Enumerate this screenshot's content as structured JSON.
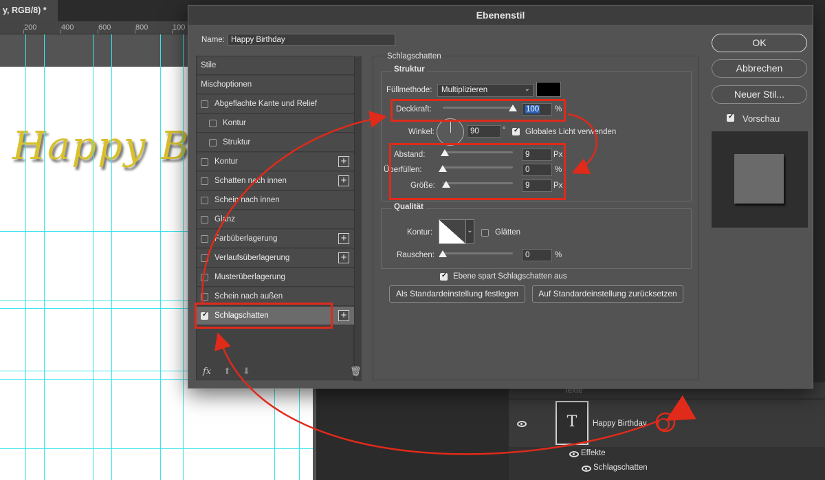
{
  "document": {
    "tab_title": "y, RGB/8) *",
    "ruler_ticks": [
      "200",
      "400",
      "600",
      "800",
      "100"
    ],
    "canvas_text": "Happy Bi"
  },
  "dialog": {
    "title": "Ebenenstil",
    "name_label": "Name:",
    "name_value": "Happy Birthday"
  },
  "styles_list": {
    "items": [
      {
        "label": "Stile",
        "checkbox": false,
        "checked": false,
        "plus": false
      },
      {
        "label": "Mischoptionen",
        "checkbox": false,
        "checked": false,
        "plus": false
      },
      {
        "label": "Abgeflachte Kante und Relief",
        "checkbox": true,
        "checked": false,
        "plus": false
      },
      {
        "label": "Kontur",
        "checkbox": true,
        "checked": false,
        "plus": false,
        "indent": true
      },
      {
        "label": "Struktur",
        "checkbox": true,
        "checked": false,
        "plus": false,
        "indent": true
      },
      {
        "label": "Kontur",
        "checkbox": true,
        "checked": false,
        "plus": true
      },
      {
        "label": "Schatten nach innen",
        "checkbox": true,
        "checked": false,
        "plus": true
      },
      {
        "label": "Schein nach innen",
        "checkbox": true,
        "checked": false,
        "plus": false
      },
      {
        "label": "Glanz",
        "checkbox": true,
        "checked": false,
        "plus": false
      },
      {
        "label": "Farbüberlagerung",
        "checkbox": true,
        "checked": false,
        "plus": true
      },
      {
        "label": "Verlaufsüberlagerung",
        "checkbox": true,
        "checked": false,
        "plus": true
      },
      {
        "label": "Musterüberlagerung",
        "checkbox": true,
        "checked": false,
        "plus": false
      },
      {
        "label": "Schein nach außen",
        "checkbox": true,
        "checked": false,
        "plus": false
      },
      {
        "label": "Schlagschatten",
        "checkbox": true,
        "checked": true,
        "plus": true,
        "active": true
      }
    ],
    "fx_label": "fx"
  },
  "shadow": {
    "section_title": "Schlagschatten",
    "structure_title": "Struktur",
    "blend_mode_label": "Füllmethode:",
    "blend_mode_value": "Multiplizieren",
    "shadow_color": "#000000",
    "opacity_label": "Deckkraft:",
    "opacity_value": "100",
    "opacity_unit": "%",
    "opacity_fraction": 1.0,
    "angle_label": "Winkel:",
    "angle_value": "90",
    "angle_unit": "°",
    "global_light_label": "Globales Licht verwenden",
    "global_light_checked": true,
    "distance_label": "Abstand:",
    "distance_value": "9",
    "distance_unit": "Px",
    "distance_fraction": 0.03,
    "spread_label": "Überfüllen:",
    "spread_value": "0",
    "spread_unit": "%",
    "spread_fraction": 0.0,
    "size_label": "Größe:",
    "size_value": "9",
    "size_unit": "Px",
    "size_fraction": 0.05,
    "quality_title": "Qualität",
    "contour_label": "Kontur:",
    "antialias_label": "Glätten",
    "antialias_checked": false,
    "noise_label": "Rauschen:",
    "noise_value": "0",
    "noise_unit": "%",
    "noise_fraction": 0.0,
    "knockout_label": "Ebene spart Schlagschatten aus",
    "knockout_checked": true,
    "make_default_label": "Als Standardeinstellung festlegen",
    "reset_default_label": "Auf Standardeinstellung zurücksetzen"
  },
  "buttons": {
    "ok": "OK",
    "cancel": "Abbrechen",
    "new_style": "Neuer Stil...",
    "preview_label": "Vorschau",
    "preview_checked": true
  },
  "layers": {
    "group_name": "Texte",
    "layer_name": "Happy Birthday",
    "effects_label": "Effekte",
    "effect_item": "Schlagschatten",
    "thumb_glyph": "T"
  },
  "annotation": {
    "highlight_color": "#e02a1a"
  }
}
